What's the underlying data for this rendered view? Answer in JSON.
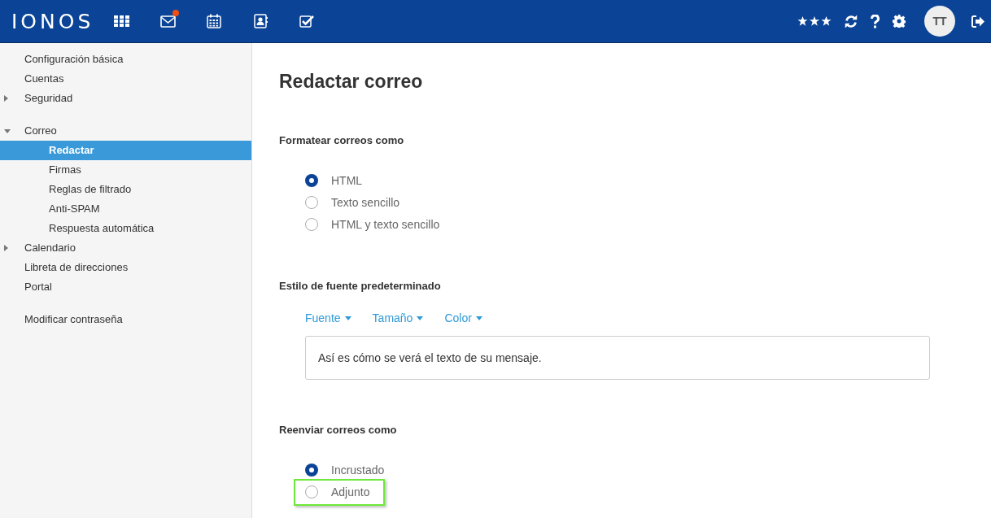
{
  "header": {
    "logo": "IONOS",
    "apps": [
      {
        "kind": "grid",
        "badge": false
      },
      {
        "kind": "mail",
        "badge": true
      },
      {
        "kind": "calendar",
        "badge": false
      },
      {
        "kind": "contacts",
        "badge": false
      },
      {
        "kind": "tasks",
        "badge": false
      }
    ],
    "tools": [
      {
        "kind": "stars"
      },
      {
        "kind": "refresh"
      },
      {
        "kind": "help"
      },
      {
        "kind": "settings"
      }
    ],
    "avatar": "TT"
  },
  "sidebar": {
    "sections": [
      {
        "items": [
          {
            "label": "Configuración básica",
            "kind": "link",
            "selected": false
          },
          {
            "label": "Cuentas",
            "kind": "link",
            "selected": false
          },
          {
            "label": "Seguridad",
            "kind": "folder",
            "expanded": false,
            "selected": false
          }
        ]
      },
      {
        "items": [
          {
            "label": "Correo",
            "kind": "folder",
            "expanded": true,
            "selected": false,
            "children": [
              {
                "label": "Redactar",
                "selected": true
              },
              {
                "label": "Firmas",
                "selected": false
              },
              {
                "label": "Reglas de filtrado",
                "selected": false
              },
              {
                "label": "Anti-SPAM",
                "selected": false
              },
              {
                "label": "Respuesta automática",
                "selected": false
              }
            ]
          },
          {
            "label": "Calendario",
            "kind": "folder",
            "expanded": false,
            "selected": false
          },
          {
            "label": "Libreta de direcciones",
            "kind": "link",
            "selected": false
          },
          {
            "label": "Portal",
            "kind": "link",
            "selected": false
          }
        ]
      },
      {
        "items": [
          {
            "label": "Modificar contraseña",
            "kind": "link",
            "selected": false
          }
        ]
      }
    ]
  },
  "main": {
    "title": "Redactar correo",
    "sections": [
      {
        "kind": "radios",
        "heading": "Formatear correos como",
        "options": [
          {
            "label": "HTML",
            "selected": true,
            "highlighted": false
          },
          {
            "label": "Texto sencillo",
            "selected": false,
            "highlighted": false
          },
          {
            "label": "HTML y texto sencillo",
            "selected": false,
            "highlighted": false
          }
        ]
      },
      {
        "kind": "font",
        "heading": "Estilo de fuente predeterminado",
        "menus": [
          "Fuente",
          "Tamaño",
          "Color"
        ],
        "preview": "Así es cómo se verá el texto de su mensaje."
      },
      {
        "kind": "radios",
        "heading": "Reenviar correos como",
        "options": [
          {
            "label": "Incrustado",
            "selected": true,
            "highlighted": false
          },
          {
            "label": "Adjunto",
            "selected": false,
            "highlighted": true
          }
        ]
      }
    ]
  }
}
